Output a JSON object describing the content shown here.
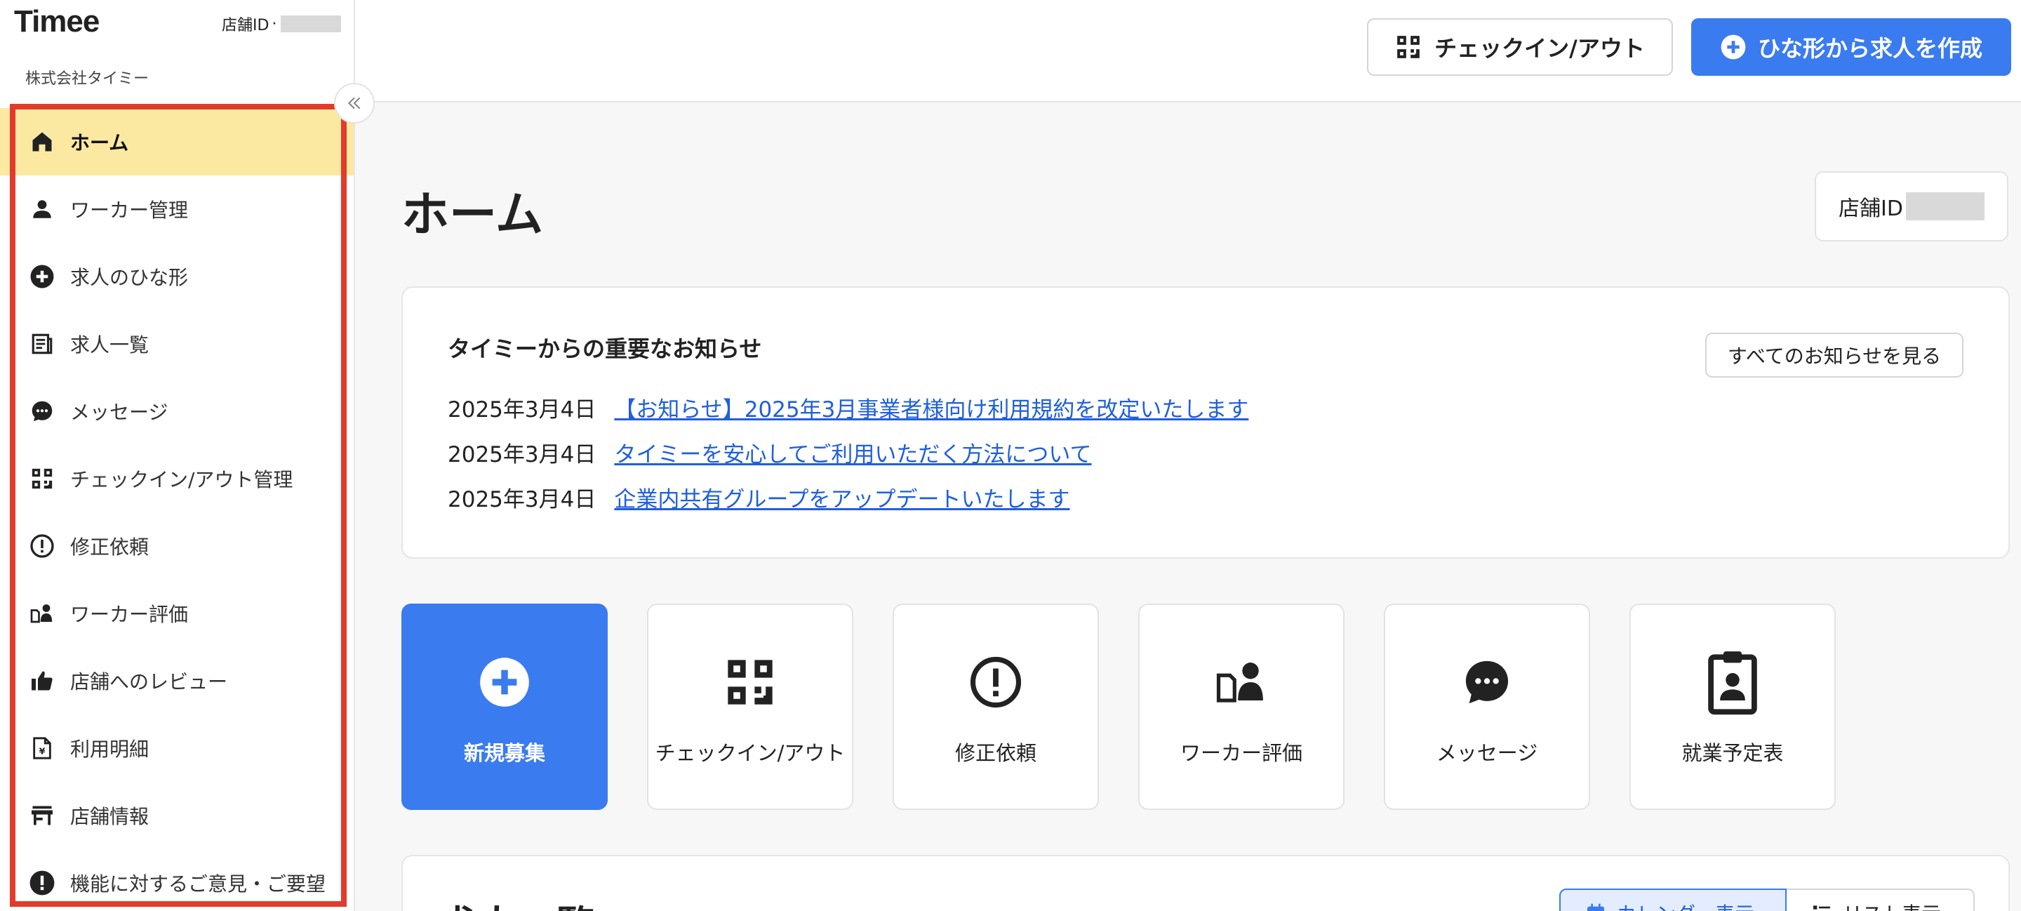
{
  "app": {
    "logo": "Timee",
    "store_id_label": "店舗ID",
    "store_id_sep": "·",
    "company": "株式会社タイミー"
  },
  "sidebar": {
    "items": [
      {
        "label": "ホーム",
        "icon": "home-icon",
        "active": true
      },
      {
        "label": "ワーカー管理",
        "icon": "person-icon"
      },
      {
        "label": "求人のひな形",
        "icon": "plus-circle-icon"
      },
      {
        "label": "求人一覧",
        "icon": "list-icon"
      },
      {
        "label": "メッセージ",
        "icon": "chat-icon"
      },
      {
        "label": "チェックイン/アウト管理",
        "icon": "qr-code-icon"
      },
      {
        "label": "修正依頼",
        "icon": "alert-circle-icon"
      },
      {
        "label": "ワーカー評価",
        "icon": "worker-rating-icon"
      },
      {
        "label": "店舗へのレビュー",
        "icon": "thumbs-up-icon"
      },
      {
        "label": "利用明細",
        "icon": "invoice-icon"
      },
      {
        "label": "店舗情報",
        "icon": "store-icon"
      },
      {
        "label": "機能に対するご意見・ご要望",
        "icon": "feedback-icon"
      }
    ]
  },
  "header": {
    "checkin_label": "チェックイン/アウト",
    "create_label": "ひな形から求人を作成"
  },
  "main": {
    "title": "ホーム",
    "store_id_label": "店舗ID",
    "notice": {
      "title": "タイミーからの重要なお知らせ",
      "see_all": "すべてのお知らせを見る",
      "items": [
        {
          "date": "2025年3月4日",
          "text": "【お知らせ】2025年3月事業者様向け利用規約を改定いたします"
        },
        {
          "date": "2025年3月4日",
          "text": "タイミーを安心してご利用いただく方法について"
        },
        {
          "date": "2025年3月4日",
          "text": "企業内共有グループをアップデートいたします"
        }
      ]
    },
    "tiles": [
      {
        "label": "新規募集",
        "icon": "plus-circle-icon"
      },
      {
        "label": "チェックイン/アウト",
        "icon": "qr-code-icon"
      },
      {
        "label": "修正依頼",
        "icon": "alert-circle-icon"
      },
      {
        "label": "ワーカー評価",
        "icon": "worker-rating-icon"
      },
      {
        "label": "メッセージ",
        "icon": "chat-icon"
      },
      {
        "label": "就業予定表",
        "icon": "clipboard-icon"
      }
    ],
    "jobs": {
      "title": "求人一覧",
      "calendar_view": "カレンダー表示",
      "list_view": "リスト表示"
    }
  },
  "colors": {
    "accent": "#3a7bef",
    "active_nav": "#fbe9a2",
    "highlight": "#e23b2c",
    "link": "#1f5fdc"
  }
}
